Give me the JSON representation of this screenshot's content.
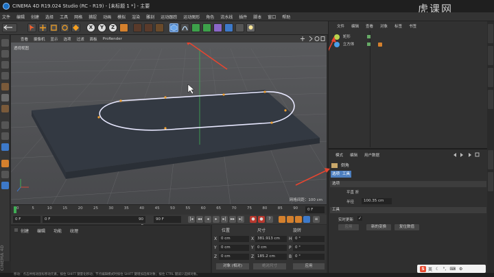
{
  "window": {
    "title": "CINEMA 4D R19.024 Studio (RC - R19) - [未标题 1 *] - 主要",
    "watermark": "虎课网"
  },
  "menubar": [
    "文件",
    "编辑",
    "创建",
    "选择",
    "工具",
    "网格",
    "捕捉",
    "动画",
    "模拟",
    "渲染",
    "雕刻",
    "运动跟踪",
    "运动图形",
    "角色",
    "流水线",
    "插件",
    "脚本",
    "窗口",
    "帮助"
  ],
  "toolbar": {
    "axis_x": "X",
    "axis_y": "Y",
    "axis_z": "Z"
  },
  "viewport": {
    "menu": [
      "查看",
      "摄像机",
      "显示",
      "选项",
      "过滤",
      "面板",
      "ProRender"
    ],
    "label": "透视视图",
    "grid_info": "网格间距：100 cm"
  },
  "timeline": {
    "ticks": [
      "0",
      "5",
      "10",
      "15",
      "20",
      "25",
      "30",
      "35",
      "40",
      "45",
      "50",
      "55",
      "60",
      "65",
      "70",
      "75",
      "80",
      "85",
      "90"
    ],
    "current_frame": "0 F"
  },
  "playback": {
    "start": "0 F",
    "min": "0 F",
    "max": "90 F",
    "end": "90 F"
  },
  "materials": {
    "menu": [
      "创建",
      "编辑",
      "功能",
      "纹理"
    ],
    "logo": "CINEMA 4D"
  },
  "coordinates": {
    "headers": [
      "位置",
      "尺寸",
      "旋转"
    ],
    "rows": [
      {
        "axis": "X",
        "pos": "0 cm",
        "size": "381.913 cm",
        "rot_axis": "H",
        "rot": "0 °"
      },
      {
        "axis": "Y",
        "pos": "0 cm",
        "size": "0 cm",
        "rot_axis": "P",
        "rot": "0 °"
      },
      {
        "axis": "Z",
        "pos": "0 cm",
        "size": "185.2 cm",
        "rot_axis": "B",
        "rot": "0 °"
      }
    ],
    "mode_object": "对象 (相对)",
    "mode_size": "绝对尺寸",
    "apply": "应用"
  },
  "object_manager": {
    "menu": [
      "文件",
      "编辑",
      "查看",
      "对象",
      "标签",
      "书签"
    ],
    "objects": [
      {
        "name": "矩形",
        "color": "#b9d14d"
      },
      {
        "name": "立方体",
        "color": "#4a9fe8"
      }
    ]
  },
  "attribute_manager": {
    "menu": [
      "模式",
      "编辑",
      "用户数据"
    ],
    "title": "倒角",
    "tabs": [
      "选项",
      "工具"
    ],
    "section_options": "选项",
    "flat_label": "平直 折",
    "radius_label": "半径",
    "radius_value": "100.35 cm",
    "section_tool": "工具",
    "realtime_label": "实时更新",
    "apply": "应用",
    "new_transform": "新的变换",
    "reset_values": "复位数值"
  },
  "statusbar": "移动：点击并拖动鼠标移动元素。按住 SHIFT 键量化移动；节点编辑模式时按住 SHIFT 键增加选择对象；按住 CTRL 键减少选择对象。",
  "ime": {
    "lang": "英"
  },
  "colors": {
    "accent": "#4d7fbf",
    "spline": "#e8e8ff",
    "point": "#f0a030",
    "annotation_arrow": "#e8452f"
  }
}
